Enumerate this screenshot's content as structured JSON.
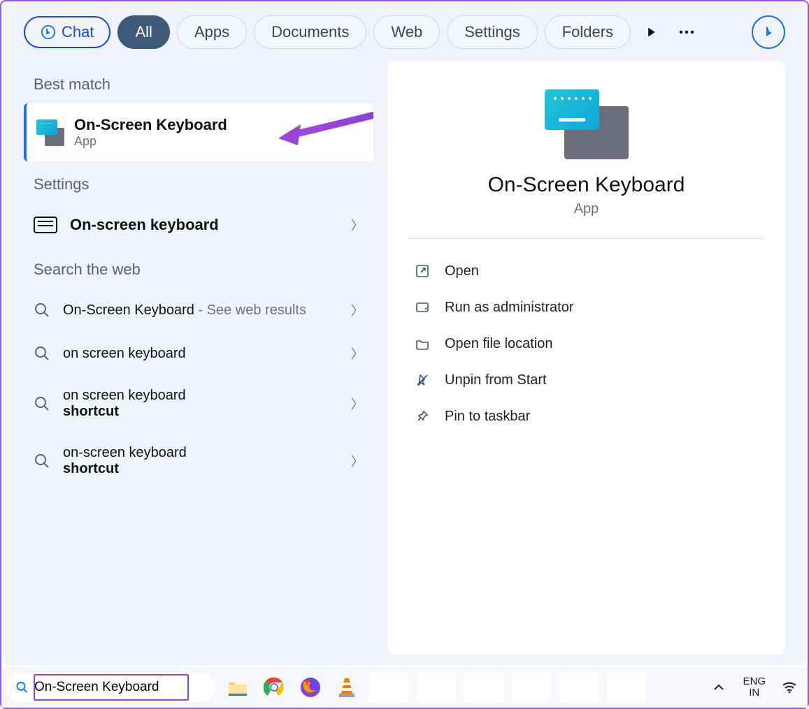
{
  "tabs": {
    "chat": "Chat",
    "all": "All",
    "apps": "Apps",
    "documents": "Documents",
    "web": "Web",
    "settings": "Settings",
    "folders": "Folders"
  },
  "sections": {
    "best_match": "Best match",
    "settings": "Settings",
    "search_web": "Search the web"
  },
  "best_match": {
    "title": "On-Screen Keyboard",
    "subtitle": "App"
  },
  "settings_item": {
    "label": "On-screen keyboard"
  },
  "web_results": [
    {
      "main": "On-Screen Keyboard",
      "suffix": " - See web results",
      "bold": ""
    },
    {
      "main": "on screen keyboard",
      "suffix": "",
      "bold": ""
    },
    {
      "main": "on screen keyboard ",
      "suffix": "",
      "bold": "shortcut"
    },
    {
      "main": "on-screen keyboard ",
      "suffix": "",
      "bold": "shortcut"
    }
  ],
  "preview": {
    "title": "On-Screen Keyboard",
    "subtitle": "App"
  },
  "actions": {
    "open": "Open",
    "admin": "Run as administrator",
    "filelocation": "Open file location",
    "unpin": "Unpin from Start",
    "pin": "Pin to taskbar"
  },
  "taskbar": {
    "search_value": "On-Screen Keyboard",
    "lang1": "ENG",
    "lang2": "IN"
  }
}
